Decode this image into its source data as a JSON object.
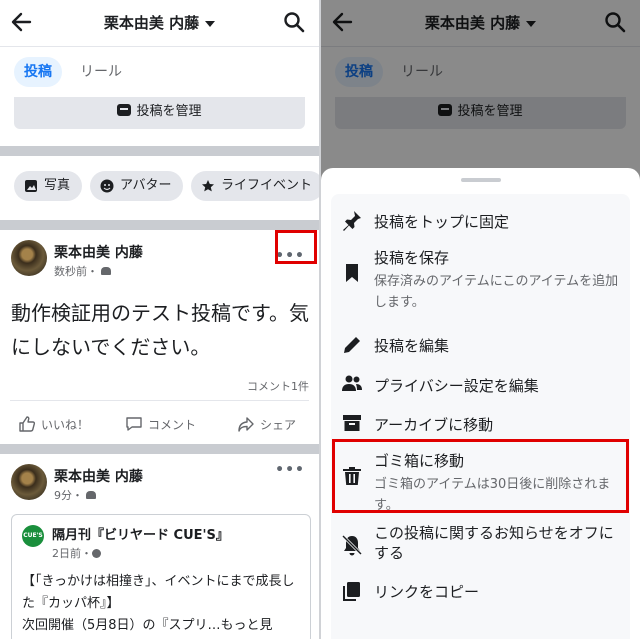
{
  "header": {
    "title": "栗本由美  内藤"
  },
  "tabs": {
    "posts": "投稿",
    "reels": "リール"
  },
  "manage_button": "投稿を管理",
  "chips": {
    "photos": "写真",
    "avatar": "アバター",
    "life_event": "ライフイベント"
  },
  "post1": {
    "author": "栗本由美  内藤",
    "time": "数秒前・",
    "body": "動作検証用のテスト投稿です。気にしないでください。",
    "comment_count": "コメント1件",
    "like_label": "いいね！",
    "comment_label": "コメント",
    "share_label": "シェア"
  },
  "post2": {
    "author": "栗本由美  内藤",
    "time": "9分・",
    "shared_page": "隔月刊『ビリヤード CUE'S』",
    "shared_logo": "CUE'S",
    "shared_time": "2日前・",
    "shared_text": "【「きっかけは相撞き」、イベントにまで成長した『カッパ杯』】\n次回開催（5月8日）の『スプリ…もっと見"
  },
  "sheet": {
    "pin": "投稿をトップに固定",
    "save": "投稿を保存",
    "save_sub": "保存済みのアイテムにこのアイテムを追加します。",
    "edit": "投稿を編集",
    "privacy": "プライバシー設定を編集",
    "archive": "アーカイブに移動",
    "trash": "ゴミ箱に移動",
    "trash_sub": "ゴミ箱のアイテムは30日後に削除されます。",
    "notify_off": "この投稿に関するお知らせをオフにする",
    "copy_link": "リンクをコピー"
  },
  "colors": {
    "accent": "#1877f2",
    "highlight": "#e00000"
  }
}
